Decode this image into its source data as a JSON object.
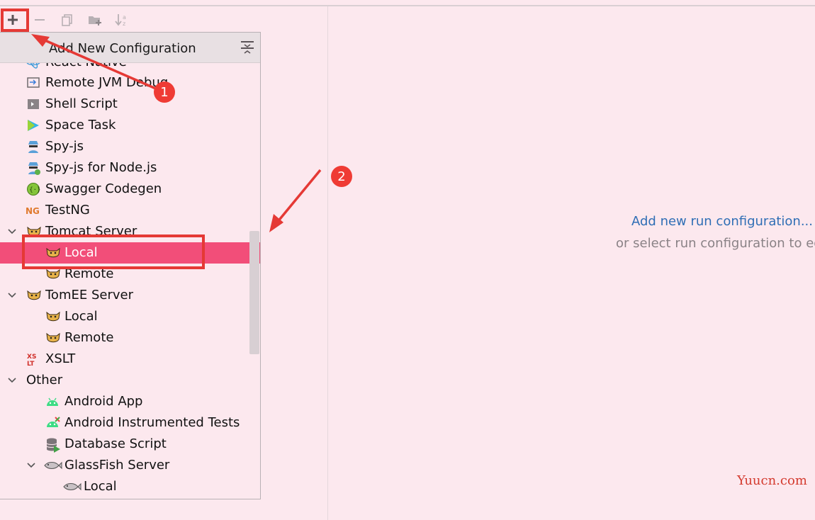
{
  "toolbar": {
    "add_icon": "plus-icon",
    "remove_icon": "minus-icon",
    "copy_icon": "copy-icon",
    "folder_icon": "new-folder-icon",
    "sort_icon": "sort-alpha-icon"
  },
  "popup": {
    "title": "Add New Configuration",
    "items": [
      {
        "label": "React Native",
        "icon": "react-icon"
      },
      {
        "label": "Remote JVM Debug",
        "icon": "remote-debug-icon"
      },
      {
        "label": "Shell Script",
        "icon": "shell-script-icon"
      },
      {
        "label": "Space Task",
        "icon": "space-icon"
      },
      {
        "label": "Spy-js",
        "icon": "spy-icon"
      },
      {
        "label": "Spy-js for Node.js",
        "icon": "spy-node-icon"
      },
      {
        "label": "Swagger Codegen",
        "icon": "swagger-icon"
      },
      {
        "label": "TestNG",
        "icon": "testng-icon"
      },
      {
        "label": "Tomcat Server",
        "icon": "tomcat-icon"
      },
      {
        "label": "Local",
        "icon": "tomcat-icon"
      },
      {
        "label": "Remote",
        "icon": "tomcat-icon"
      },
      {
        "label": "TomEE Server",
        "icon": "tomcat-icon"
      },
      {
        "label": "Local",
        "icon": "tomcat-icon"
      },
      {
        "label": "Remote",
        "icon": "tomcat-icon"
      },
      {
        "label": "XSLT",
        "icon": "xslt-icon"
      },
      {
        "label": "Other",
        "icon": ""
      },
      {
        "label": "Android App",
        "icon": "android-icon"
      },
      {
        "label": "Android Instrumented Tests",
        "icon": "android-test-icon"
      },
      {
        "label": "Database Script",
        "icon": "database-script-icon"
      },
      {
        "label": "GlassFish Server",
        "icon": "glassfish-icon"
      },
      {
        "label": "Local",
        "icon": "glassfish-icon"
      }
    ]
  },
  "main": {
    "add_link": "Add new run configuration...",
    "select_text": "or select run configuration to edit"
  },
  "annotations": {
    "badge1": "1",
    "badge2": "2"
  },
  "watermark": "Yuucn.com",
  "colors": {
    "selection": "#f24e79",
    "link": "#2f6eb5",
    "annotation": "#e53935"
  }
}
